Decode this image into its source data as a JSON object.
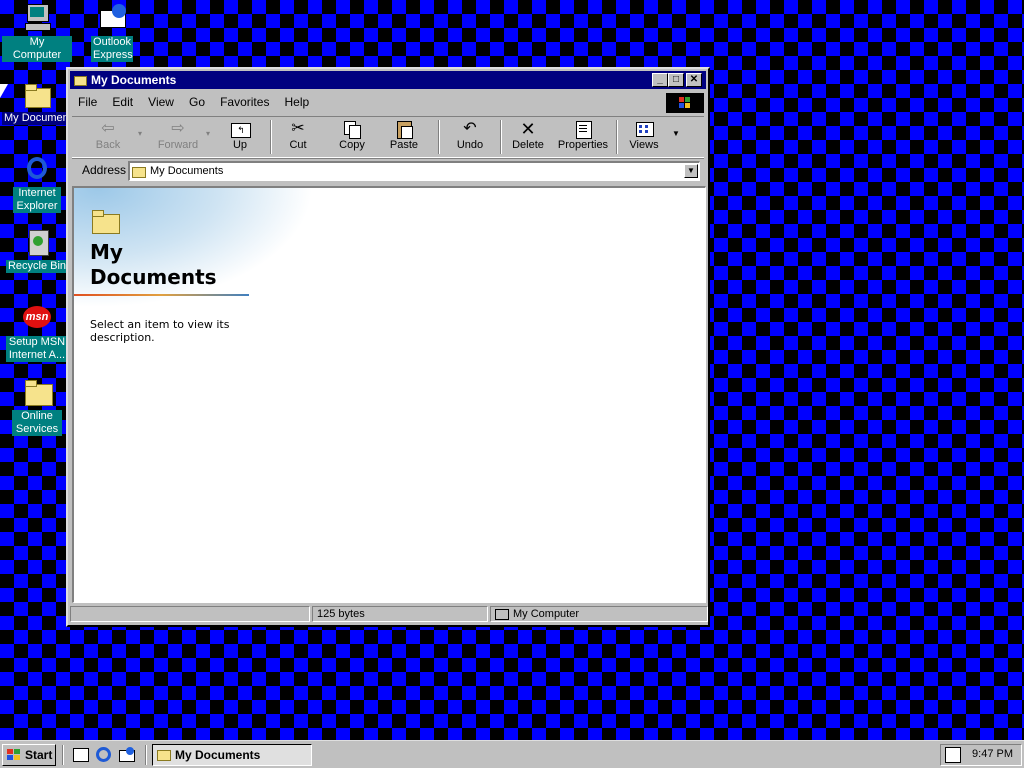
{
  "desktop": {
    "icons": [
      {
        "label": "My Computer"
      },
      {
        "label": "Outlook Express"
      },
      {
        "label": "My Documents"
      },
      {
        "label": "Internet Explorer"
      },
      {
        "label": "Recycle Bin"
      },
      {
        "label": "Setup MSN Internet A..."
      },
      {
        "label": "Online Services"
      }
    ]
  },
  "window": {
    "title": "My Documents",
    "menu": [
      "File",
      "Edit",
      "View",
      "Go",
      "Favorites",
      "Help"
    ],
    "toolbar": {
      "back": "Back",
      "forward": "Forward",
      "up": "Up",
      "cut": "Cut",
      "copy": "Copy",
      "paste": "Paste",
      "undo": "Undo",
      "delete": "Delete",
      "properties": "Properties",
      "views": "Views"
    },
    "address": {
      "label": "Address",
      "value": "My Documents"
    },
    "content": {
      "title_line1": "My",
      "title_line2": "Documents",
      "description": "Select an item to view its description."
    },
    "status": {
      "size": "125 bytes",
      "zone": "My Computer"
    }
  },
  "taskbar": {
    "start": "Start",
    "task": "My Documents",
    "clock": "9:47 PM"
  }
}
